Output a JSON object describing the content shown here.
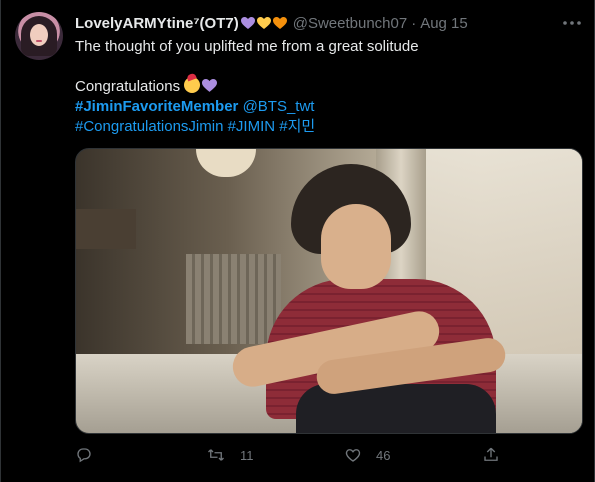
{
  "tweet": {
    "author_name": "LovelyARMYtine⁷(OT7)",
    "author_handle": "@Sweetbunch07",
    "separator": "·",
    "date": "Aug 15",
    "hearts": [
      "#ab8ee0",
      "#ffcc4d",
      "#f4900c"
    ],
    "body_line1": "The thought of you uplifted me from a great solitude",
    "body_line2": "Congratulations",
    "hashtag_jimin_favorite": "#JiminFavoriteMember",
    "mention_bts": "@BTS_twt",
    "hashtag_congratulations": "#CongratulationsJimin",
    "hashtag_jimin": "#JIMIN",
    "hashtag_korean": "#지민",
    "emoji_celebration": "partying-face",
    "emoji_heart_color": "#ab8ee0"
  },
  "actions": {
    "reply_icon": "reply-icon",
    "retweet_icon": "retweet-icon",
    "retweet_count": "11",
    "like_icon": "heart-icon",
    "like_count": "46",
    "share_icon": "share-icon"
  },
  "colors": {
    "background": "#000000",
    "text": "#e7e9ea",
    "muted": "#71767b",
    "link": "#1d9bf0",
    "border": "#2f3336"
  }
}
